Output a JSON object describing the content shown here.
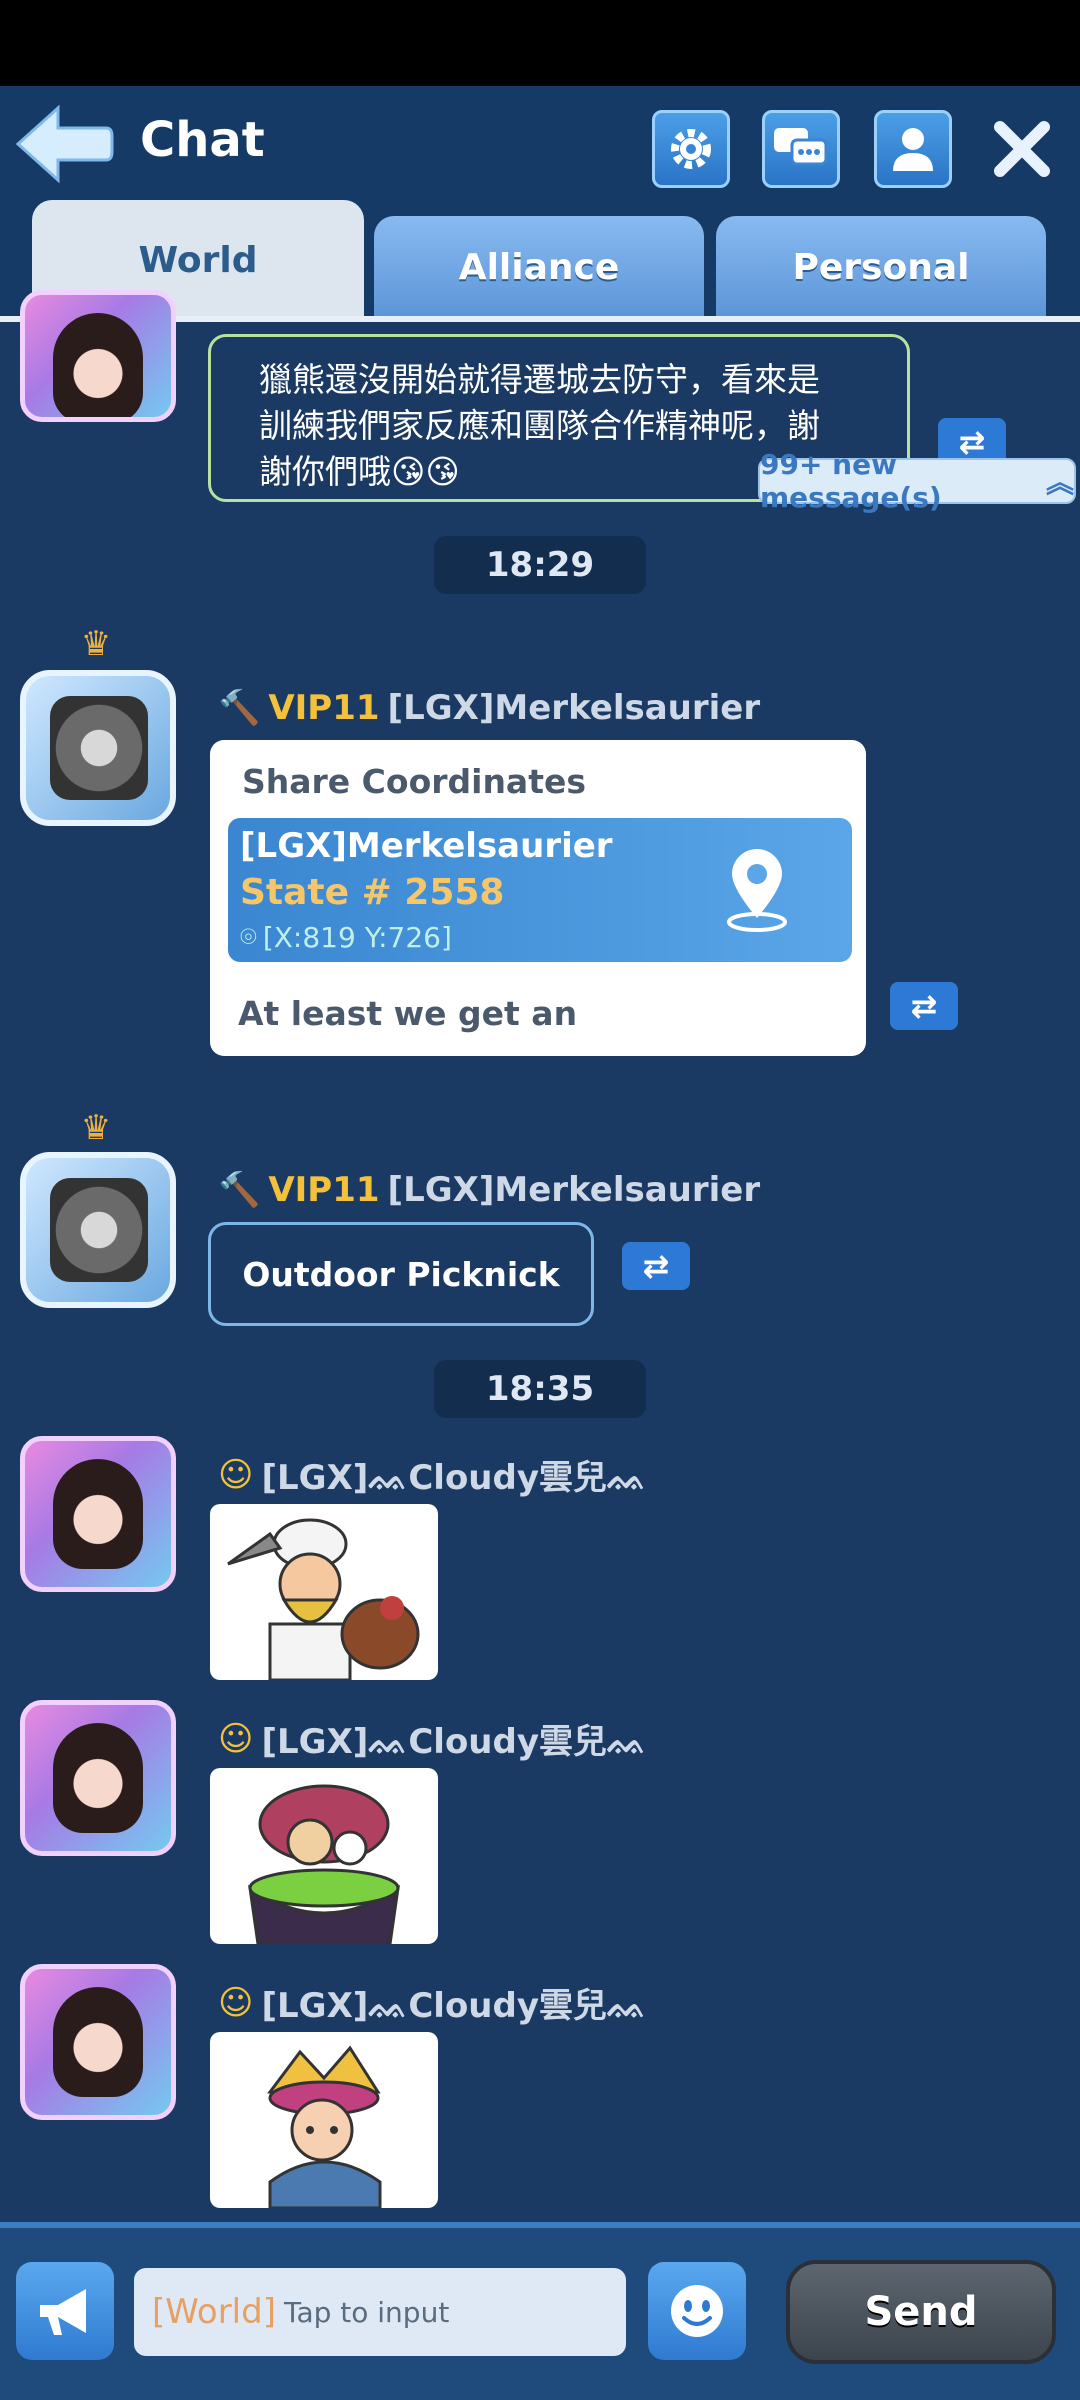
{
  "header": {
    "title": "Chat"
  },
  "tabs": [
    {
      "label": "World",
      "active": true
    },
    {
      "label": "Alliance",
      "active": false
    },
    {
      "label": "Personal",
      "active": false
    }
  ],
  "messages": {
    "m1": {
      "text_lines": [
        "獵熊還沒開始就得遷城去防守，看來是",
        "訓練我們家反應和團隊合作精神呢，謝",
        "謝你們哦😘😘"
      ]
    },
    "new_messages": "99+ new message(s)",
    "time1": "18:29",
    "m2": {
      "vip": "VIP11",
      "name": "[LGX]Merkelsaurier",
      "card_title": "Share Coordinates",
      "coord_name": "[LGX]Merkelsaurier",
      "state": "State # 2558",
      "coords": "[X:819 Y:726]",
      "text": "At least we get an"
    },
    "m3": {
      "vip": "VIP11",
      "name": "[LGX]Merkelsaurier",
      "text": "Outdoor Picknick"
    },
    "time2": "18:35",
    "m4": {
      "name": "[LGX]ᨐCloudy雲兒ᨐ"
    },
    "m5": {
      "name": "[LGX]ᨐCloudy雲兒ᨐ"
    },
    "m6": {
      "name": "[LGX]ᨐCloudy雲兒ᨐ"
    }
  },
  "input": {
    "channel_tag": "[World]",
    "placeholder": "Tap to input",
    "send_label": "Send"
  },
  "colors": {
    "background": "#1b3a63",
    "vip": "#f3c13c",
    "accent": "#2d7ad6"
  }
}
